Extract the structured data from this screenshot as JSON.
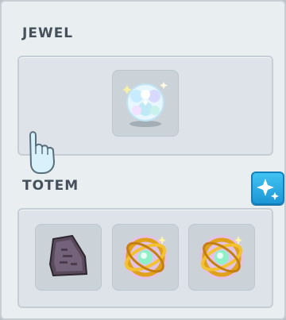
{
  "jewel": {
    "title": "JEWEL",
    "slots": [
      {
        "icon": "crystal-jewel-icon"
      }
    ],
    "add_button_icon": "sparkle-icon"
  },
  "totem": {
    "title": "TOTEM",
    "slots": [
      {
        "icon": "stone-totem-icon"
      },
      {
        "icon": "golden-ring-totem-icon"
      },
      {
        "icon": "golden-ring-totem-icon"
      }
    ]
  },
  "cursor": {
    "icon": "pointing-hand-cursor-icon"
  },
  "colors": {
    "panel_bg": "#e9eef1",
    "section_text": "#45505a",
    "accent_button": "#2aa9e4"
  }
}
